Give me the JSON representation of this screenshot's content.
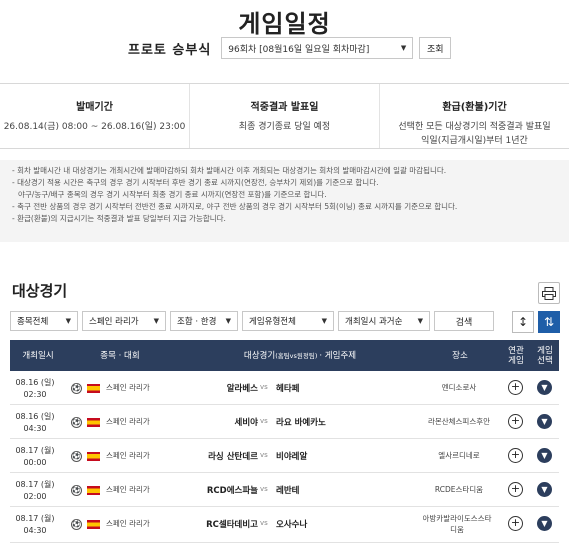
{
  "page": {
    "title": "게임일정"
  },
  "round": {
    "label": "프로토 승부식",
    "selected": "96회차 [08월16일 일요일 회차마감]",
    "button": "조회"
  },
  "info": [
    {
      "head": "발매기간",
      "text": "26.08.14(금) 08:00 ~ 26.08.16(일) 23:00",
      "text2": ""
    },
    {
      "head": "적중결과 발표일",
      "text": "최종 경기종료 당일 예정",
      "text2": ""
    },
    {
      "head": "환급(환불)기간",
      "text": "선택한 모든 대상경기의 적중결과 발표일",
      "text2": "익일(지급개시일)부터 1년간"
    }
  ],
  "notes": [
    "- 회차 발매시간 내 대상경기는 개최시간에 발매마감하되 회차 발매시간 이후 개최되는 대상경기는 회차의 발매마감시간에 일괄 마감됩니다.",
    "- 대상경기 적용 시간은 축구의 경우 경기 시작부터 후반 경기 종료 시까지(연장전, 승부차기 제외)를 기준으로 합니다.",
    "야구/농구/배구 종목의 경우 경기 시작부터 최종 경기 종료 시까지(연장전 포함)를 기준으로 합니다.",
    "- 축구 전반 상품의 경우 경기 시작부터 전반전 종료 시까지로, 야구 전반 상품의 경우 경기 시작부터 5회(이닝) 종료 시까지를 기준으로 합니다.",
    "- 환급(환불)의 지급시기는 적중결과 발표 당일부터 지급 가능합니다."
  ],
  "section": {
    "title": "대상경기"
  },
  "filters": {
    "sport": "종목전체",
    "league": "스페인 라리가",
    "combo": "조합 · 한경",
    "type": "게임유형전체",
    "order": "개최일시 과거순",
    "search": "검색"
  },
  "table": {
    "headers": {
      "date": "개최일시",
      "sport": "종목 · 대회",
      "match": "대상경기",
      "match_small": "(홈팀vs원정팀)",
      "match_tail": "· 게임주제",
      "venue": "장소",
      "related": "연관\n게임",
      "select": "게임\n선택"
    },
    "rows": [
      {
        "date": "08.16 (일)",
        "time": "02:30",
        "league": "스페인 라리가",
        "home": "알라베스",
        "vs": "vs",
        "away": "헤타페",
        "venue": "멘디소로사"
      },
      {
        "date": "08.16 (일)",
        "time": "04:30",
        "league": "스페인 라리가",
        "home": "세비야",
        "vs": "vs",
        "away": "라요 바예카노",
        "venue": "라몬산체스피스후안"
      },
      {
        "date": "08.17 (월)",
        "time": "00:00",
        "league": "스페인 라리가",
        "home": "라싱 산탄데르",
        "vs": "vs",
        "away": "비야레알",
        "venue": "엘사르디네로"
      },
      {
        "date": "08.17 (월)",
        "time": "02:00",
        "league": "스페인 라리가",
        "home": "RCD에스파뇰",
        "vs": "vs",
        "away": "레반테",
        "venue": "RCDE스타디움"
      },
      {
        "date": "08.17 (월)",
        "time": "04:30",
        "league": "스페인 라리가",
        "home": "RC셀타데비고",
        "vs": "vs",
        "away": "오사수나",
        "venue": "아방카발라이도스스타디움"
      }
    ]
  },
  "colors": {
    "header_bg": "#2c3e5d",
    "accent": "#1f5ea8",
    "notes_bg": "#f4f4f4"
  }
}
